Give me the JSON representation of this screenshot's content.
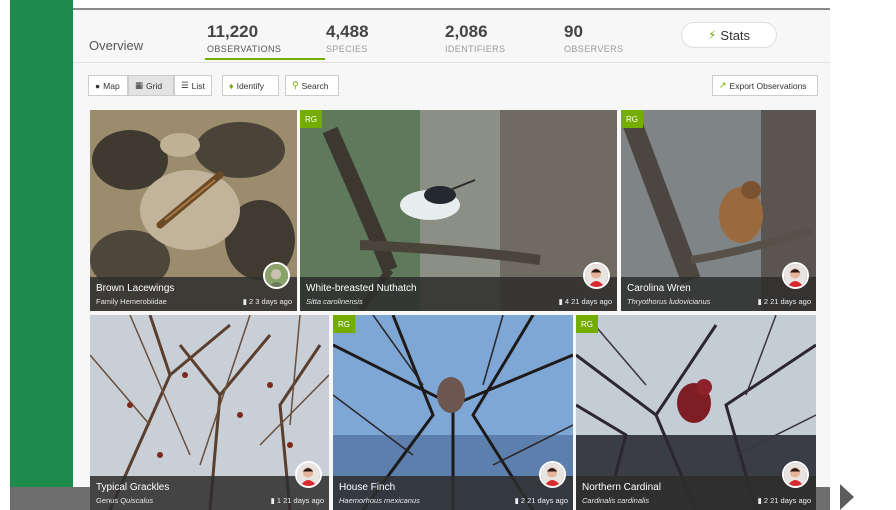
{
  "header": {
    "overview_label": "Overview",
    "stats": [
      {
        "value": "11,220",
        "label": "OBSERVATIONS"
      },
      {
        "value": "4,488",
        "label": "SPECIES"
      },
      {
        "value": "2,086",
        "label": "IDENTIFIERS"
      },
      {
        "value": "90",
        "label": "OBSERVERS"
      }
    ],
    "stats_button": "Stats"
  },
  "toolbar": {
    "map": "Map",
    "grid": "Grid",
    "list": "List",
    "identify": "Identify",
    "search": "Search",
    "export": "Export Observations"
  },
  "observations": [
    {
      "name": "Brown Lacewings",
      "sci": "Family Hemerobiidae",
      "ids": "2",
      "when": "3 days ago",
      "rg": ""
    },
    {
      "name": "White-breasted Nuthatch",
      "sci": "Sitta carolinensis",
      "ids": "4",
      "when": "21 days ago",
      "rg": "RG"
    },
    {
      "name": "Carolina Wren",
      "sci": "Thryothorus ludovicianus",
      "ids": "2",
      "when": "21 days ago",
      "rg": "RG"
    },
    {
      "name": "Typical Grackles",
      "sci": "Genus Quiscalus",
      "ids": "1",
      "when": "21 days ago",
      "rg": ""
    },
    {
      "name": "House Finch",
      "sci": "Haemorhous mexicanus",
      "ids": "2",
      "when": "21 days ago",
      "rg": "RG"
    },
    {
      "name": "Northern Cardinal",
      "sci": "Cardinalis cardinalis",
      "ids": "2",
      "when": "21 days ago",
      "rg": "RG"
    }
  ],
  "colors": {
    "brand_green": "#74ac00",
    "sidebar_green": "#1e8a4c",
    "caption_bg": "#2d2d2d"
  }
}
